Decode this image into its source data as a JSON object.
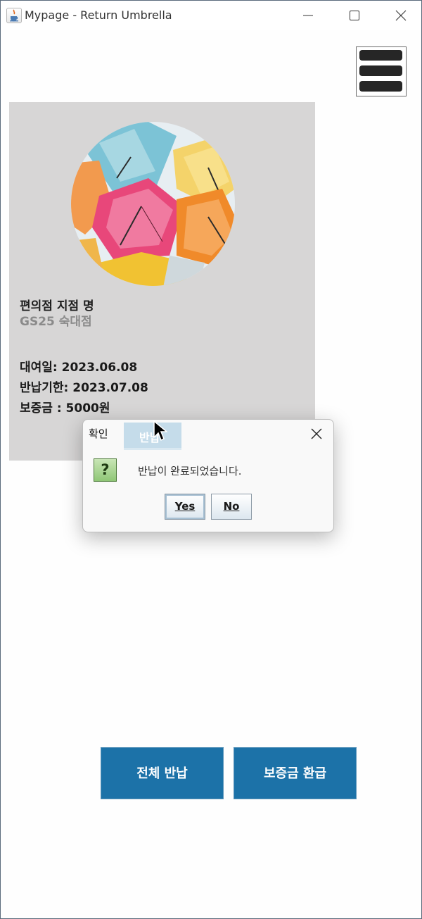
{
  "window": {
    "title": "Mypage - Return Umbrella",
    "controls": [
      "minimize-icon",
      "maximize-icon",
      "close-icon"
    ]
  },
  "menu": {
    "icon": "hamburger-menu-icon"
  },
  "card": {
    "image": "umbrellas-photo",
    "store_label": "편의점 지점 명",
    "store_name": "GS25 숙대점",
    "rental_date": "대여일: 2023.06.08",
    "due_date": "반납기한: 2023.07.08",
    "deposit": "보증금 : 5000원"
  },
  "dialog": {
    "title": "확인",
    "ghost_tab_label": "반납",
    "icon": "question-icon",
    "message": "반납이 완료되었습니다.",
    "yes_label": "Yes",
    "no_label": "No"
  },
  "actions": {
    "return_all_label": "전체 반납",
    "refund_label": "보증금 환급"
  },
  "colors": {
    "card_bg": "#d7d6d6",
    "action_blue": "#1c72a8",
    "dialog_bg": "#f9f9f9"
  }
}
